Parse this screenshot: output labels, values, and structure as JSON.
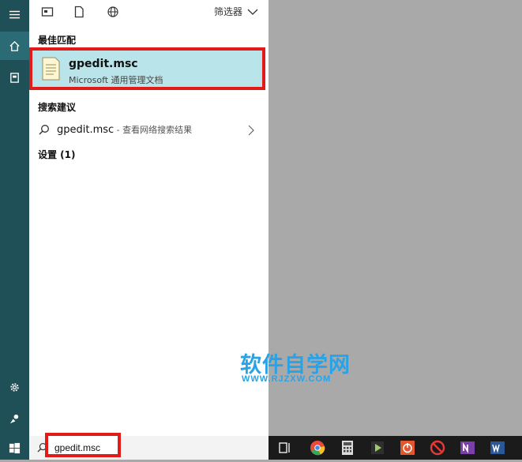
{
  "topbar": {
    "filter_label": "筛选器"
  },
  "sections": {
    "best_match": "最佳匹配",
    "search_suggestions": "搜索建议",
    "settings": "设置 (1)"
  },
  "best_match_item": {
    "title": "gpedit.msc",
    "subtitle": "Microsoft 通用管理文档"
  },
  "suggestion": {
    "query": "gpedit.msc",
    "action": " - 查看网络搜索结果"
  },
  "search": {
    "value": "gpedit.msc"
  },
  "watermark": {
    "title": "软件自学网",
    "url": "WWW.RJZXW.COM"
  },
  "colors": {
    "accent_highlight": "#b9e4ea",
    "annotation_red": "#e11a1a",
    "rail": "#1f4f57"
  }
}
